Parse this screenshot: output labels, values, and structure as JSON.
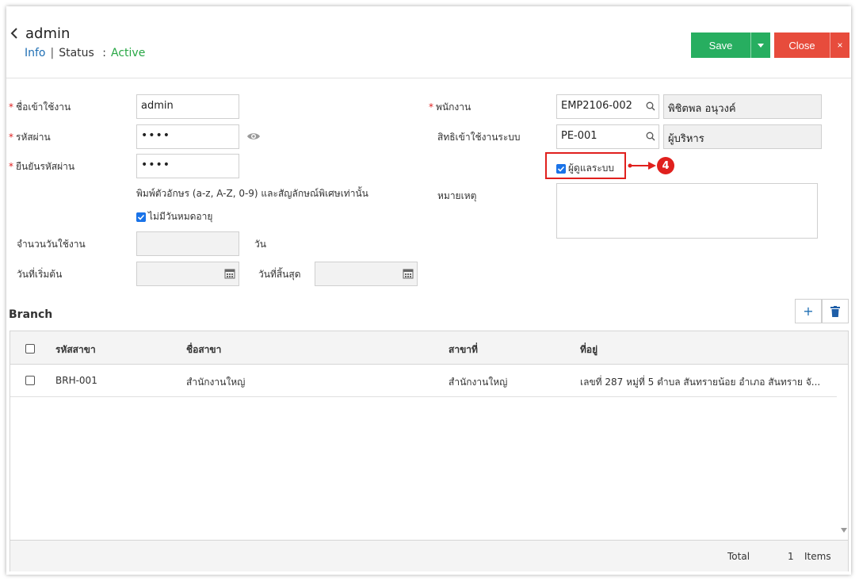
{
  "header": {
    "title": "admin",
    "info_label": "Info",
    "status_label": "Status",
    "status_colon": ":",
    "status_value": "Active",
    "save_label": "Save",
    "close_label": "Close",
    "close_x": "×"
  },
  "form": {
    "username_label": "ชื่อเข้าใช้งาน",
    "username_value": "admin",
    "password_label": "รหัสผ่าน",
    "password_value": "••••",
    "confirm_label": "ยืนยันรหัสผ่าน",
    "confirm_value": "••••",
    "password_hint": "พิมพ์ตัวอักษร (a-z, A-Z, 0-9) และสัญลักษณ์พิเศษเท่านั้น",
    "no_expiry_label": "ไม่มีวันหมดอายุ",
    "days_label": "จำนวนวันใช้งาน",
    "days_unit": "วัน",
    "start_label": "วันที่เริ่มต้น",
    "end_label": "วันที่สิ้นสุด",
    "employee_label": "พนักงาน",
    "employee_code": "EMP2106-002",
    "employee_name": "พิชิตพล อนุวงค์",
    "role_label": "สิทธิเข้าใช้งานระบบ",
    "role_code": "PE-001",
    "role_name": "ผู้บริหาร",
    "admin_label": "ผู้ดูแลระบบ",
    "remark_label": "หมายเหตุ",
    "annotation_number": "4"
  },
  "branch": {
    "title": "Branch",
    "add_label": "+",
    "columns": [
      "รหัสสาขา",
      "ชื่อสาขา",
      "สาขาที่",
      "ที่อยู่"
    ],
    "rows": [
      [
        "BRH-001",
        "สำนักงานใหญ่",
        "สำนักงานใหญ่",
        "เลขที่ 287 หมู่ที่ 5 ตำบล สันทรายน้อย อำเภอ สันทราย จั..."
      ]
    ],
    "total_label": "Total",
    "total_count": "1",
    "items_label": "Items"
  },
  "colors": {
    "save": "#27ae60",
    "close": "#e74c3c",
    "active": "#28a745",
    "info": "#1f6fb4",
    "required": "#e02020",
    "annotation": "#e0201d",
    "checkbox": "#1a73e8"
  }
}
